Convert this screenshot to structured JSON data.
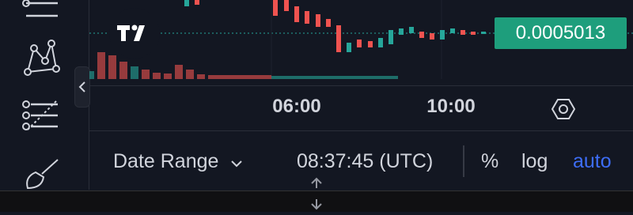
{
  "price": {
    "last": "0.0005013",
    "color": "#1e9e7c"
  },
  "time_axis": {
    "ticks": [
      {
        "label": "06:00"
      },
      {
        "label": "10:00"
      }
    ]
  },
  "bottom_bar": {
    "date_range_label": "Date Range",
    "clock": "08:37:45 (UTC)",
    "percent_label": "%",
    "log_label": "log",
    "auto_label": "auto"
  },
  "colors": {
    "up": "#26a69a",
    "down": "#ef5350",
    "accent": "#3d6df6",
    "background": "#131722"
  },
  "icons": [
    "hamburger-lines-icon",
    "pattern-nodes-icon",
    "fib-lines-icon",
    "brush-icon",
    "chevron-left-icon",
    "settings-hexagon-icon",
    "tradingview-logo-icon",
    "updown-arrows-icon"
  ]
}
